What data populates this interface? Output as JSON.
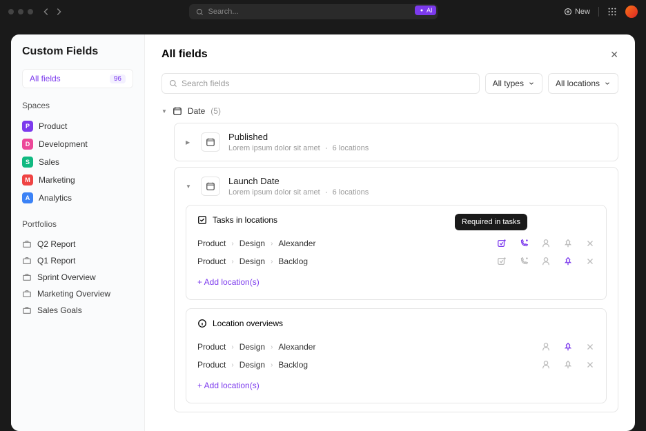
{
  "topbar": {
    "search_placeholder": "Search...",
    "ai_label": "AI",
    "new_label": "New"
  },
  "sidebar": {
    "title": "Custom Fields",
    "tab_label": "All fields",
    "tab_count": "96",
    "spaces_label": "Spaces",
    "spaces": [
      {
        "letter": "P",
        "label": "Product",
        "color": "#7c3aed"
      },
      {
        "letter": "D",
        "label": "Development",
        "color": "#ec4899"
      },
      {
        "letter": "S",
        "label": "Sales",
        "color": "#10b981"
      },
      {
        "letter": "M",
        "label": "Marketing",
        "color": "#ef4444"
      },
      {
        "letter": "A",
        "label": "Analytics",
        "color": "#3b82f6"
      }
    ],
    "portfolios_label": "Portfolios",
    "portfolios": [
      {
        "label": "Q2 Report"
      },
      {
        "label": "Q1 Report"
      },
      {
        "label": "Sprint Overview"
      },
      {
        "label": "Marketing Overview"
      },
      {
        "label": "Sales Goals"
      }
    ]
  },
  "main": {
    "title": "All fields",
    "search_placeholder": "Search fields",
    "filter_types": "All types",
    "filter_locations": "All locations",
    "group_label": "Date",
    "group_count": "(5)",
    "fields": [
      {
        "name": "Published",
        "desc": "Lorem ipsum dolor sit amet",
        "locations": "6 locations"
      },
      {
        "name": "Launch Date",
        "desc": "Lorem ipsum dolor sit amet",
        "locations": "6 locations"
      }
    ],
    "tasks_section": {
      "title": "Tasks in locations",
      "rows": [
        {
          "p1": "Product",
          "p2": "Design",
          "p3": "Alexander"
        },
        {
          "p1": "Product",
          "p2": "Design",
          "p3": "Backlog"
        }
      ],
      "add_label": "+ Add location(s)"
    },
    "overview_section": {
      "title": "Location overviews",
      "rows": [
        {
          "p1": "Product",
          "p2": "Design",
          "p3": "Alexander"
        },
        {
          "p1": "Product",
          "p2": "Design",
          "p3": "Backlog"
        }
      ],
      "add_label": "+ Add location(s)"
    },
    "tooltip": "Required in tasks"
  }
}
